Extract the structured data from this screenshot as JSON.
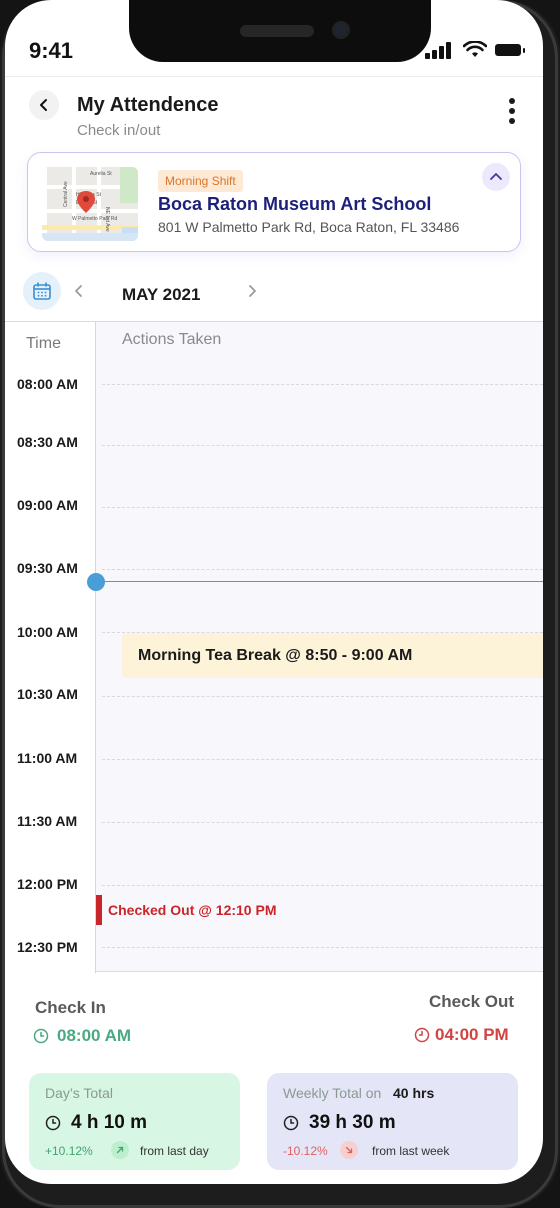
{
  "status_bar": {
    "time": "9:41"
  },
  "header": {
    "title": "My Attendence",
    "subtitle": "Check in/out"
  },
  "location": {
    "shift": "Morning Shift",
    "name": "Boca Raton Museum Art School",
    "address": "801 W Palmetto Park Rd, Boca Raton, FL 33486",
    "map_streets": [
      "Aurelia St",
      "Hibiscus St",
      "Estella St",
      "Central Ave",
      "NE 1st Ave",
      "W Palmetto Park Rd"
    ]
  },
  "calendar": {
    "month": "MAY 2021"
  },
  "timeline": {
    "time_header": "Time",
    "actions_header": "Actions Taken",
    "slots": [
      "08:00 AM",
      "08:30 AM",
      "09:00 AM",
      "09:30 AM",
      "10:00 AM",
      "10:30 AM",
      "11:00 AM",
      "11:30 AM",
      "12:00 PM",
      "12:30 PM"
    ],
    "break_event": "Morning Tea  Break @ 8:50 - 9:00 AM",
    "checkout_event": "Checked Out @ 12:10 PM"
  },
  "summary": {
    "check_in_label": "Check In",
    "check_in_time": "08:00 AM",
    "check_out_label": "Check Out",
    "check_out_time": "04:00 PM"
  },
  "day_total": {
    "title": "Day’s Total",
    "value": "4 h 10 m",
    "change": "+10.12%",
    "compare": "from last day"
  },
  "weekly_total": {
    "title": "Weekly Total on",
    "target": "40 hrs",
    "value": "39 h 30 m",
    "change": "-10.12%",
    "compare": "from last week"
  },
  "colors": {
    "accent_navy": "#1d1f7a",
    "positive": "#48a982",
    "negative": "#d14444",
    "now_indicator": "#4a9ed8",
    "break_bg": "#fcf3d8"
  }
}
